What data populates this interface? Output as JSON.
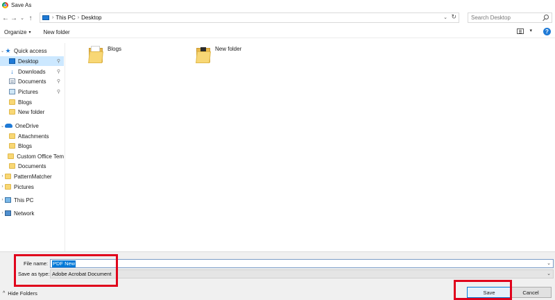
{
  "window": {
    "title": "Save As"
  },
  "nav": {
    "back": "←",
    "forward": "→",
    "recent": "⌄",
    "up": "↑",
    "breadcrumb": [
      "This PC",
      "Desktop"
    ],
    "search_placeholder": "Search Desktop"
  },
  "toolbar": {
    "organize": "Organize",
    "new_folder": "New folder",
    "help": "?"
  },
  "sidebar": {
    "items": [
      {
        "label": "Quick access",
        "icon": "star-icon"
      },
      {
        "label": "Desktop",
        "icon": "desktop-icon",
        "selected": true,
        "pinned": true
      },
      {
        "label": "Downloads",
        "icon": "download-icon",
        "pinned": true
      },
      {
        "label": "Documents",
        "icon": "documents-icon",
        "pinned": true
      },
      {
        "label": "Pictures",
        "icon": "pictures-icon",
        "pinned": true
      },
      {
        "label": "Blogs",
        "icon": "folder-icon"
      },
      {
        "label": "New folder",
        "icon": "folder-icon"
      },
      {
        "label": "OneDrive",
        "icon": "onedrive-icon"
      },
      {
        "label": "Attachments",
        "icon": "folder-icon"
      },
      {
        "label": "Blogs",
        "icon": "folder-icon"
      },
      {
        "label": "Custom Office Tem",
        "icon": "folder-icon"
      },
      {
        "label": "Documents",
        "icon": "folder-icon"
      },
      {
        "label": "PatternMatcher",
        "icon": "folder-icon"
      },
      {
        "label": "Pictures",
        "icon": "folder-icon"
      },
      {
        "label": "This PC",
        "icon": "this-pc-icon"
      },
      {
        "label": "Network",
        "icon": "network-icon"
      }
    ]
  },
  "content": {
    "items": [
      {
        "name": "Blogs",
        "icon": "folder-icon"
      },
      {
        "name": "New folder",
        "icon": "folder-icon"
      }
    ]
  },
  "form": {
    "filename_label": "File name:",
    "filename_value": "PDF New",
    "savetype_label": "Save as type:",
    "savetype_value": "Adobe Acrobat Document"
  },
  "footer": {
    "hide_folders": "Hide Folders",
    "save": "Save",
    "cancel": "Cancel"
  },
  "colors": {
    "accent": "#0078d7",
    "highlight": "#e0001b",
    "folder": "#f8d775",
    "selected_bg": "#cce8ff"
  }
}
